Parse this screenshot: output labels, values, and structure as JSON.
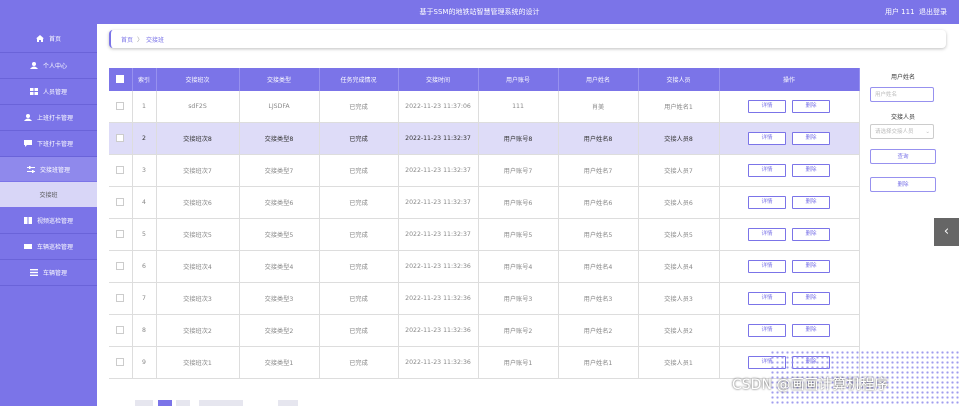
{
  "header": {
    "title": "基于SSM的地铁站智慧管理系统的设计",
    "user": "用户 111",
    "logout": "退出登录"
  },
  "sidebar": {
    "items": [
      {
        "label": "首页",
        "icon": "home-icon"
      },
      {
        "label": "个人中心",
        "icon": "user-icon"
      },
      {
        "label": "人员管理",
        "icon": "grid-icon"
      },
      {
        "label": "上班打卡管理",
        "icon": "user-icon"
      },
      {
        "label": "下班打卡管理",
        "icon": "chat-icon"
      },
      {
        "label": "交接班管理",
        "icon": "sliders-icon"
      },
      {
        "label": "交接班",
        "icon": ""
      },
      {
        "label": "视频巡检管理",
        "icon": "book-icon"
      },
      {
        "label": "车辆巡检管理",
        "icon": "ticket-icon"
      },
      {
        "label": "车辆管理",
        "icon": "list-icon"
      }
    ]
  },
  "breadcrumb": {
    "home": "首页",
    "sep": "〉",
    "current": "交接班"
  },
  "table": {
    "headers": [
      "索引",
      "交接班次",
      "交接类型",
      "任务完成情况",
      "交接时间",
      "用户账号",
      "用户姓名",
      "交接人员",
      "操作"
    ],
    "detail_label": "详情",
    "delete_label": "删除",
    "rows": [
      [
        "1",
        "sdF2S",
        "LJSDFA",
        "已完成",
        "2022-11-23 11:37:06",
        "111",
        "肖美",
        "用户姓名1"
      ],
      [
        "2",
        "交接班次8",
        "交接类型8",
        "已完成",
        "2022-11-23 11:32:37",
        "用户账号8",
        "用户姓名8",
        "交接人员8"
      ],
      [
        "3",
        "交接班次7",
        "交接类型7",
        "已完成",
        "2022-11-23 11:32:37",
        "用户账号7",
        "用户姓名7",
        "交接人员7"
      ],
      [
        "4",
        "交接班次6",
        "交接类型6",
        "已完成",
        "2022-11-23 11:32:37",
        "用户账号6",
        "用户姓名6",
        "交接人员6"
      ],
      [
        "5",
        "交接班次5",
        "交接类型5",
        "已完成",
        "2022-11-23 11:32:37",
        "用户账号5",
        "用户姓名5",
        "交接人员5"
      ],
      [
        "6",
        "交接班次4",
        "交接类型4",
        "已完成",
        "2022-11-23 11:32:36",
        "用户账号4",
        "用户姓名4",
        "交接人员4"
      ],
      [
        "7",
        "交接班次3",
        "交接类型3",
        "已完成",
        "2022-11-23 11:32:36",
        "用户账号3",
        "用户姓名3",
        "交接人员3"
      ],
      [
        "8",
        "交接班次2",
        "交接类型2",
        "已完成",
        "2022-11-23 11:32:36",
        "用户账号2",
        "用户姓名2",
        "交接人员2"
      ],
      [
        "9",
        "交接班次1",
        "交接类型1",
        "已完成",
        "2022-11-23 11:32:36",
        "用户账号1",
        "用户姓名1",
        "交接人员1"
      ]
    ]
  },
  "search": {
    "name_label": "用户姓名",
    "name_placeholder": "用户姓名",
    "handover_label": "交接人员",
    "handover_placeholder": "请选择交接人员",
    "query": "查询",
    "delete": "删除"
  },
  "watermark": "CSDN @画画计算机程序",
  "colors": {
    "accent": "#7b74e8"
  }
}
